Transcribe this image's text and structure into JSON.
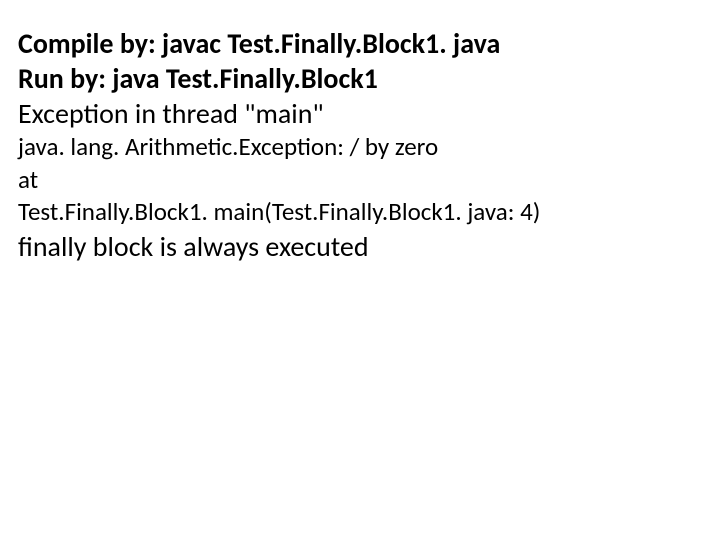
{
  "lines": {
    "compile_label": "Compile by:",
    "compile_value": " javac Test.Finally.Block1. java",
    "run_label": "Run by:",
    "run_value": " java Test.Finally.Block1",
    "exception_thread": "Exception in thread \"main\"",
    "exception_type": "java. lang. Arithmetic.Exception: / by zero",
    "at": "at",
    "stack_frame": "Test.Finally.Block1. main(Test.Finally.Block1. java: 4)",
    "finally_msg": "finally block is always executed"
  }
}
